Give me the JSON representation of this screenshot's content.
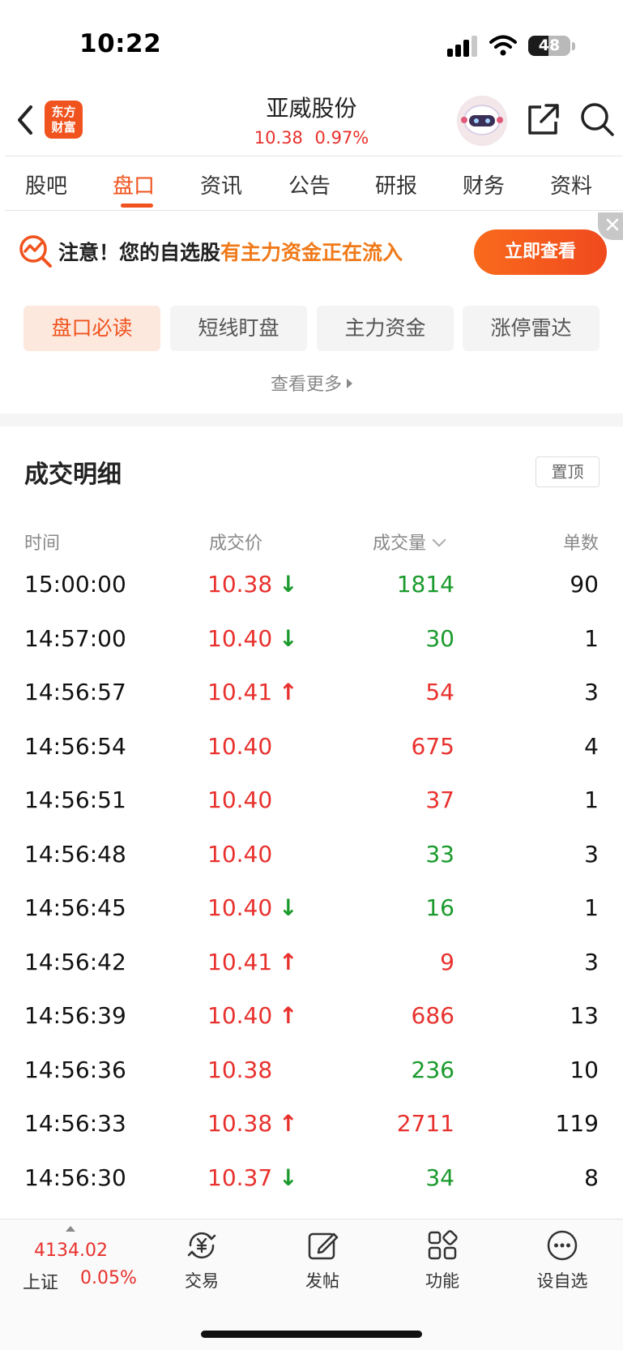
{
  "status_bar": {
    "time": "10:22",
    "battery": "48",
    "battery_fraction": 0.48
  },
  "header": {
    "app_logo_line1": "东方",
    "app_logo_line2": "财富",
    "stock_name": "亚威股份",
    "price": "10.38",
    "change_pct": "0.97%"
  },
  "tabs": [
    {
      "label": "股吧"
    },
    {
      "label": "盘口",
      "active": true
    },
    {
      "label": "资讯"
    },
    {
      "label": "公告"
    },
    {
      "label": "研报"
    },
    {
      "label": "财务"
    },
    {
      "label": "资料"
    }
  ],
  "notice": {
    "prefix": "注意！您的自选股",
    "highlight": "有主力资金正在流入",
    "button": "立即查看"
  },
  "chips": [
    {
      "label": "盘口必读",
      "active": true
    },
    {
      "label": "短线盯盘"
    },
    {
      "label": "主力资金"
    },
    {
      "label": "涨停雷达"
    }
  ],
  "see_more": "查看更多",
  "trade_detail": {
    "title": "成交明细",
    "pin_label": "置顶",
    "columns": {
      "time": "时间",
      "price": "成交价",
      "volume": "成交量",
      "count": "单数"
    },
    "rows": [
      {
        "time": "15:00:00",
        "price": "10.38",
        "dir": "down",
        "volume": "1814",
        "vol_color": "green",
        "count": "90"
      },
      {
        "time": "14:57:00",
        "price": "10.40",
        "dir": "down",
        "volume": "30",
        "vol_color": "green",
        "count": "1"
      },
      {
        "time": "14:56:57",
        "price": "10.41",
        "dir": "up",
        "volume": "54",
        "vol_color": "red",
        "count": "3"
      },
      {
        "time": "14:56:54",
        "price": "10.40",
        "dir": "",
        "volume": "675",
        "vol_color": "red",
        "count": "4"
      },
      {
        "time": "14:56:51",
        "price": "10.40",
        "dir": "",
        "volume": "37",
        "vol_color": "red",
        "count": "1"
      },
      {
        "time": "14:56:48",
        "price": "10.40",
        "dir": "",
        "volume": "33",
        "vol_color": "green",
        "count": "3"
      },
      {
        "time": "14:56:45",
        "price": "10.40",
        "dir": "down",
        "volume": "16",
        "vol_color": "green",
        "count": "1"
      },
      {
        "time": "14:56:42",
        "price": "10.41",
        "dir": "up",
        "volume": "9",
        "vol_color": "red",
        "count": "3"
      },
      {
        "time": "14:56:39",
        "price": "10.40",
        "dir": "up",
        "volume": "686",
        "vol_color": "red",
        "count": "13"
      },
      {
        "time": "14:56:36",
        "price": "10.38",
        "dir": "",
        "volume": "236",
        "vol_color": "green",
        "count": "10"
      },
      {
        "time": "14:56:33",
        "price": "10.38",
        "dir": "up",
        "volume": "2711",
        "vol_color": "red",
        "count": "119"
      },
      {
        "time": "14:56:30",
        "price": "10.37",
        "dir": "down",
        "volume": "34",
        "vol_color": "green",
        "count": "8"
      }
    ]
  },
  "bottom_bar": {
    "index_value": "4134.02",
    "index_name": "上证",
    "index_change": "0.05%",
    "nav": [
      {
        "label": "交易",
        "icon": "trade-yuan-icon"
      },
      {
        "label": "发帖",
        "icon": "compose-icon"
      },
      {
        "label": "功能",
        "icon": "grid-icon"
      },
      {
        "label": "设自选",
        "icon": "more-circle-icon"
      }
    ]
  },
  "colors": {
    "accent": "#f0531d",
    "up": "#e8312d",
    "down": "#1a9a2c",
    "notice_highlight": "#f07a1a"
  }
}
